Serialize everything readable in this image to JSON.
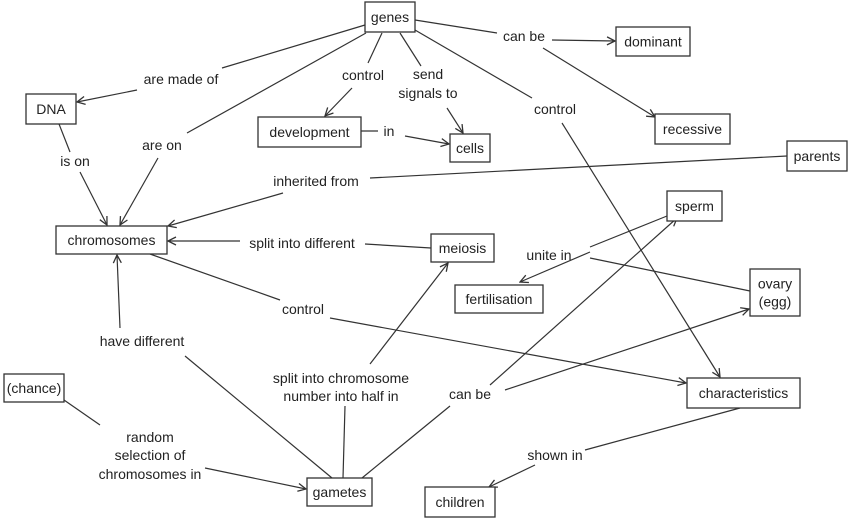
{
  "concepts": {
    "genes": "genes",
    "dominant": "dominant",
    "dna": "DNA",
    "development": "development",
    "cells": "cells",
    "recessive": "recessive",
    "parents": "parents",
    "sperm": "sperm",
    "chromosomes": "chromosomes",
    "meiosis": "meiosis",
    "fertilisation": "fertilisation",
    "ovary_line1": "ovary",
    "ovary_line2": "(egg)",
    "characteristics": "characteristics",
    "chance": "(chance)",
    "gametes": "gametes",
    "children": "children"
  },
  "links": {
    "are_made_of": "are made of",
    "is_on": "is on",
    "are_on": "are on",
    "control_development": "control",
    "send_line1": "send",
    "send_line2": "signals to",
    "can_be_dominance": "can be",
    "control_characteristics": "control",
    "in": "in",
    "inherited_from": "inherited from",
    "split_into_different": "split into different",
    "unite_in": "unite in",
    "chromosomes_control": "control",
    "have_different": "have different",
    "split_half_line1": "split into chromosome",
    "split_half_line2": "number into half in",
    "can_be_gametes": "can be",
    "random_line1": "random",
    "random_line2": "selection of",
    "random_line3": "chromosomes in",
    "shown_in": "shown in"
  },
  "colors": {
    "line": "#333333",
    "text": "#222222",
    "background": "#ffffff"
  }
}
